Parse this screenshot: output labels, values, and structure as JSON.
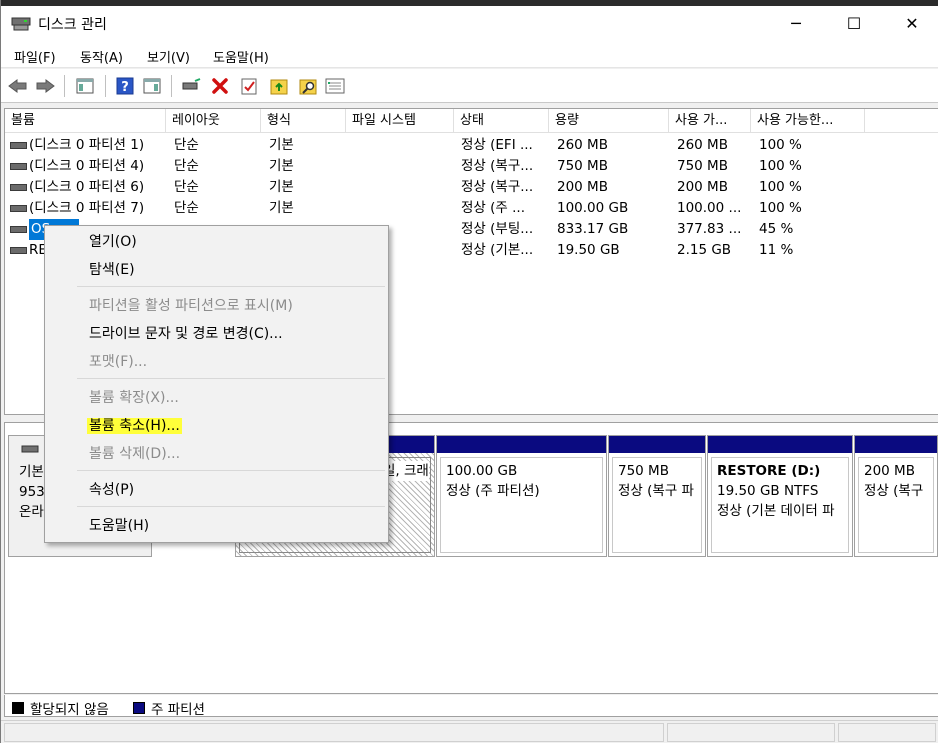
{
  "window": {
    "title": "디스크 관리",
    "minimize": "─",
    "maximize": "☐",
    "close": "✕"
  },
  "menu": [
    "파일(F)",
    "동작(A)",
    "보기(V)",
    "도움말(H)"
  ],
  "toolbar": {
    "icons": [
      "back-icon",
      "forward-icon",
      "console-tree-icon",
      "help-icon",
      "action-pane-icon",
      "connect-drive-icon",
      "delete-icon",
      "properties-icon",
      "open-folder-icon",
      "explore-icon",
      "settings-list-icon"
    ]
  },
  "list": {
    "columns": [
      "볼륨",
      "레이아웃",
      "형식",
      "파일 시스템",
      "상태",
      "용량",
      "사용 가...",
      "사용 가능한..."
    ],
    "rows": [
      {
        "volume": "(디스크 0 파티션 1)",
        "layout": "단순",
        "type": "기본",
        "fs": "",
        "status": "정상 (EFI ...",
        "capacity": "260 MB",
        "free": "260 MB",
        "pct": "100 %"
      },
      {
        "volume": "(디스크 0 파티션 4)",
        "layout": "단순",
        "type": "기본",
        "fs": "",
        "status": "정상 (복구...",
        "capacity": "750 MB",
        "free": "750 MB",
        "pct": "100 %"
      },
      {
        "volume": "(디스크 0 파티션 6)",
        "layout": "단순",
        "type": "기본",
        "fs": "",
        "status": "정상 (복구...",
        "capacity": "200 MB",
        "free": "200 MB",
        "pct": "100 %"
      },
      {
        "volume": "(디스크 0 파티션 7)",
        "layout": "단순",
        "type": "기본",
        "fs": "",
        "status": "정상 (주 ...",
        "capacity": "100.00 GB",
        "free": "100.00 ...",
        "pct": "100 %"
      },
      {
        "volume": "OS",
        "layout": "",
        "type": "",
        "fs": "",
        "status": "정상 (부팅...",
        "capacity": "833.17 GB",
        "free": "377.83 ...",
        "pct": "45 %"
      },
      {
        "volume": "RE",
        "layout": "",
        "type": "",
        "fs": "",
        "status": "정상 (기본...",
        "capacity": "19.50 GB",
        "free": "2.15 GB",
        "pct": "11 %"
      }
    ]
  },
  "disk": {
    "label_lines": [
      "기본",
      "953.",
      "온라"
    ],
    "partitions": [
      {
        "name": "",
        "lines": [
          "",
          "일, 크래"
        ]
      },
      {
        "name": "",
        "lines": [
          "100.00 GB",
          "정상 (주 파티션)"
        ]
      },
      {
        "name": "",
        "lines": [
          "750 MB",
          "정상 (복구 파"
        ]
      },
      {
        "name": "RESTORE  (D:)",
        "lines": [
          "19.50 GB NTFS",
          "정상 (기본 데이터 파"
        ]
      },
      {
        "name": "",
        "lines": [
          "200 MB",
          "정상 (복구"
        ]
      }
    ]
  },
  "legend": [
    {
      "label": "할당되지 않음",
      "color": "#000000"
    },
    {
      "label": "주 파티션",
      "color": "#0a0a80"
    }
  ],
  "context_menu": {
    "items": [
      {
        "label": "열기(O)",
        "disabled": false
      },
      {
        "label": "탐색(E)",
        "disabled": false
      },
      {
        "label": "파티션을 활성 파티션으로 표시(M)",
        "disabled": true
      },
      {
        "label": "드라이브 문자 및 경로 변경(C)...",
        "disabled": false
      },
      {
        "label": "포맷(F)...",
        "disabled": true
      },
      {
        "label": "볼륨 확장(X)...",
        "disabled": true
      },
      {
        "label": "볼륨 축소(H)...",
        "disabled": false
      },
      {
        "label": "볼륨 삭제(D)...",
        "disabled": true
      },
      {
        "label": "속성(P)",
        "disabled": false
      },
      {
        "label": "도움말(H)",
        "disabled": false
      }
    ]
  },
  "colors": {
    "primary_partition": "#0a0a80",
    "highlight": "#ffff3a",
    "selection": "#0078d7"
  }
}
